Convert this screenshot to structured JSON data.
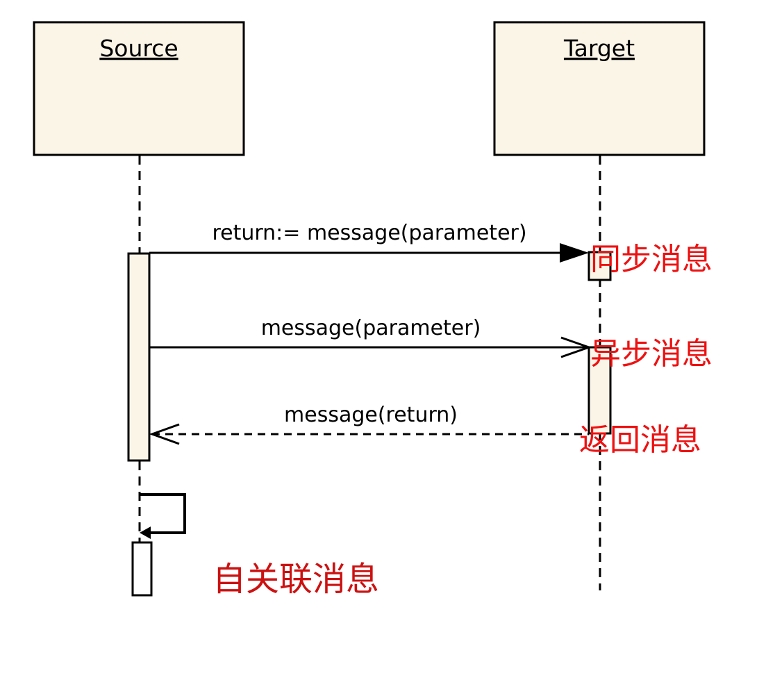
{
  "lifelines": {
    "source": {
      "name": "Source"
    },
    "target": {
      "name": "Target"
    }
  },
  "messages": {
    "sync": {
      "label": "return:= message(parameter)",
      "note": "同步消息"
    },
    "async": {
      "label": "message(parameter)",
      "note": "异步消息"
    },
    "reply": {
      "label": "message(return)",
      "note": "返回消息"
    },
    "self": {
      "note": "自关联消息"
    }
  },
  "colors": {
    "box_fill": "#fbf5e8",
    "annotation": "#ee1111",
    "line": "#000000"
  }
}
